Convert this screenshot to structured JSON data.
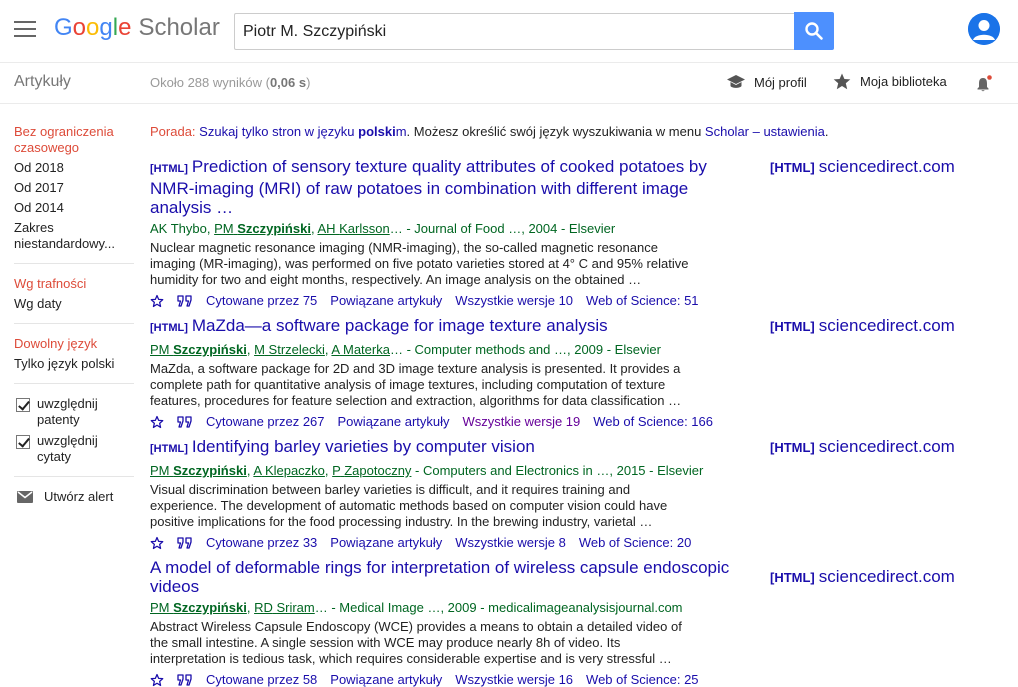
{
  "header": {
    "logo_letters": [
      "G",
      "o",
      "o",
      "g",
      "l",
      "e"
    ],
    "logo_product": "Scholar",
    "search_value": "Piotr M. Szczypiński"
  },
  "subbar": {
    "articles": "Artykuły",
    "results_prefix": "Około 288 wyników (",
    "results_time": "0,06 s",
    "results_suffix": ")",
    "my_profile": "Mój profil",
    "my_library": "Moja biblioteka"
  },
  "sidebar": {
    "time": [
      "Bez ograniczenia czasowego",
      "Od 2018",
      "Od 2017",
      "Od 2014",
      "Zakres niestandardowy..."
    ],
    "sort": [
      "Wg trafności",
      "Wg daty"
    ],
    "lang": [
      "Dowolny język",
      "Tylko język polski"
    ],
    "include_patents": "uwzględnij patenty",
    "include_citations": "uwzględnij cytaty",
    "create_alert": "Utwórz alert"
  },
  "tip": {
    "label": "Porada:",
    "link1_a": "Szukaj tylko stron w języku ",
    "link1_b": "polski",
    "link1_c": "m",
    "text": ". Możesz określić swój język wyszukiwania w menu ",
    "link2": "Scholar – ustawienia",
    "end": "."
  },
  "results": [
    {
      "tag": "[HTML]",
      "title": "Prediction of sensory texture quality attributes of cooked potatoes by NMR-imaging (MRI) of raw potatoes in combination with different image analysis …",
      "authors": [
        {
          "first": "AK",
          "last": "Thybo",
          "bold": false,
          "link": false
        },
        {
          "first": "PM",
          "last": "Szczypiński",
          "bold": true,
          "link": true
        },
        {
          "first": "AH",
          "last": "Karlsson",
          "bold": false,
          "link": true
        }
      ],
      "authors_tail": "… - Journal of Food …, 2004 - Elsevier",
      "snippet": "Nuclear magnetic resonance imaging (NMR-imaging), the so-called magnetic resonance imaging (MR-imaging), was performed on five potato varieties stored at 4° C and 95% relative humidity for two and eight months, respectively. An image analysis on the obtained …",
      "cited": "Cytowane przez 75",
      "related": "Powiązane artykuły",
      "versions": "Wszystkie wersje 10",
      "wos": "Web of Science: 51",
      "versions_visited": false,
      "side_tag": "[HTML]",
      "side_domain": "sciencedirect.com"
    },
    {
      "tag": "[HTML]",
      "title": "MaZda—a software package for image texture analysis",
      "authors": [
        {
          "first": "PM",
          "last": "Szczypiński",
          "bold": true,
          "link": true
        },
        {
          "first": "M",
          "last": "Strzelecki",
          "bold": false,
          "link": true
        },
        {
          "first": "A",
          "last": "Materka",
          "bold": false,
          "link": true
        }
      ],
      "authors_tail": "… - Computer methods and …, 2009 - Elsevier",
      "snippet": "MaZda, a software package for 2D and 3D image texture analysis is presented. It provides a complete path for quantitative analysis of image textures, including computation of texture features, procedures for feature selection and extraction, algorithms for data classification …",
      "cited": "Cytowane przez 267",
      "related": "Powiązane artykuły",
      "versions": "Wszystkie wersje 19",
      "wos": "Web of Science: 166",
      "versions_visited": true,
      "side_tag": "[HTML]",
      "side_domain": "sciencedirect.com"
    },
    {
      "tag": "[HTML]",
      "title": "Identifying barley varieties by computer vision",
      "authors": [
        {
          "first": "PM",
          "last": "Szczypiński",
          "bold": true,
          "link": true
        },
        {
          "first": "A",
          "last": "Klepaczko",
          "bold": false,
          "link": true
        },
        {
          "first": "P",
          "last": "Zapotoczny",
          "bold": false,
          "link": true
        }
      ],
      "authors_tail": " - Computers and Electronics in …, 2015 - Elsevier",
      "snippet": "Visual discrimination between barley varieties is difficult, and it requires training and experience. The development of automatic methods based on computer vision could have positive implications for the food processing industry. In the brewing industry, varietal …",
      "cited": "Cytowane przez 33",
      "related": "Powiązane artykuły",
      "versions": "Wszystkie wersje 8",
      "wos": "Web of Science: 20",
      "versions_visited": false,
      "side_tag": "[HTML]",
      "side_domain": "sciencedirect.com"
    },
    {
      "tag": "",
      "title": "A model of deformable rings for interpretation of wireless capsule endoscopic videos",
      "authors": [
        {
          "first": "PM",
          "last": "Szczypiński",
          "bold": true,
          "link": true
        },
        {
          "first": "RD",
          "last": "Sriram",
          "bold": false,
          "link": true
        }
      ],
      "authors_tail": "… - Medical Image …, 2009 - medicalimageanalysisjournal.com",
      "snippet": "Abstract Wireless Capsule Endoscopy (WCE) provides a means to obtain a detailed video of the small intestine. A single session with WCE may produce nearly 8h of video. Its interpretation is tedious task, which requires considerable expertise and is very stressful …",
      "cited": "Cytowane przez 58",
      "related": "Powiązane artykuły",
      "versions": "Wszystkie wersje 16",
      "wos": "Web of Science: 25",
      "versions_visited": false,
      "side_tag": "[HTML]",
      "side_domain": "sciencedirect.com"
    }
  ],
  "colors": {
    "link": "#1a0dab",
    "visited": "#660099",
    "green": "#006621",
    "selected": "#dd4b39",
    "search_button": "#4d90fe"
  }
}
